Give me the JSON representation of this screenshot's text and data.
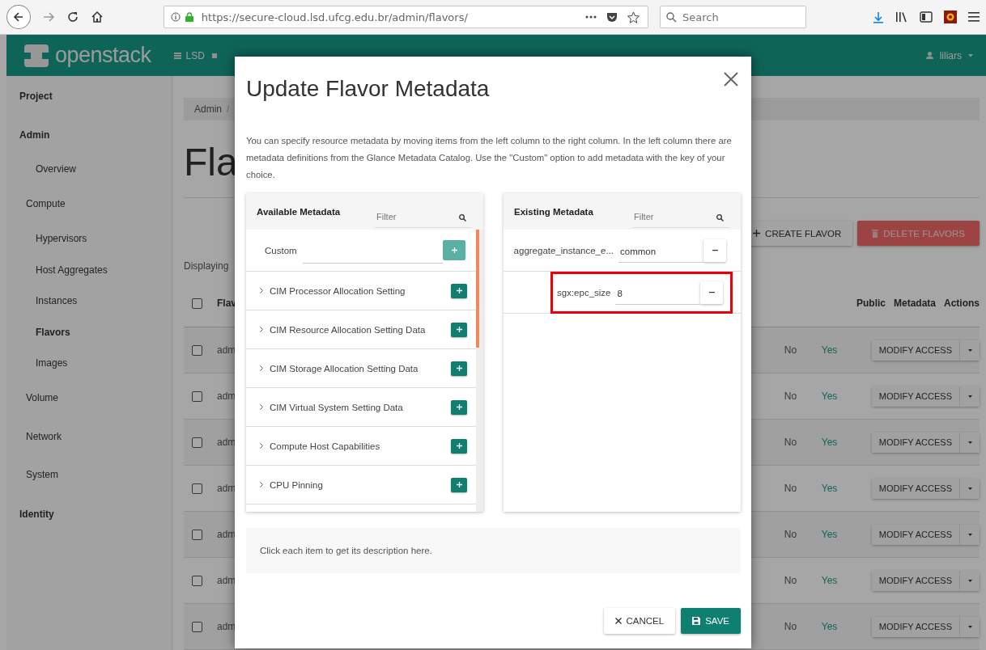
{
  "browser": {
    "url": "https://secure-cloud.lsd.ufcg.edu.br/admin/flavors/",
    "search_placeholder": "Search"
  },
  "header": {
    "logo": "openstack",
    "project": "LSD",
    "user": "liliars"
  },
  "sidebar": [
    {
      "label": "Project",
      "kind": "section"
    },
    {
      "label": "Admin",
      "kind": "section",
      "children": [
        {
          "label": "Overview",
          "kind": "item",
          "selected": false
        },
        {
          "label": "Compute",
          "kind": "group",
          "children": [
            {
              "label": "Hypervisors",
              "kind": "item",
              "selected": false
            },
            {
              "label": "Host Aggregates",
              "kind": "item",
              "selected": false
            },
            {
              "label": "Instances",
              "kind": "item",
              "selected": false
            },
            {
              "label": "Flavors",
              "kind": "item",
              "selected": true
            },
            {
              "label": "Images",
              "kind": "item",
              "selected": false
            }
          ]
        },
        {
          "label": "Volume",
          "kind": "group"
        },
        {
          "label": "Network",
          "kind": "group"
        },
        {
          "label": "System",
          "kind": "group"
        }
      ]
    },
    {
      "label": "Identity",
      "kind": "section"
    }
  ],
  "breadcrumb": {
    "items": [
      "Admin"
    ],
    "separator": "/"
  },
  "page_title": "Fla",
  "actions": [
    {
      "label": "CREATE FLAVOR",
      "kind": "create"
    },
    {
      "label": "DELETE FLAVORS",
      "kind": "delete"
    }
  ],
  "displaying": "Displaying",
  "table": {
    "select_all_checked": false,
    "columns": [
      "Flav",
      "Public",
      "Metadata",
      "Actions"
    ],
    "rows": [
      {
        "name": "adm",
        "checked": false,
        "public": "No",
        "metadata": "Yes",
        "action": "MODIFY ACCESS"
      },
      {
        "name": "adm",
        "checked": false,
        "public": "No",
        "metadata": "Yes",
        "action": "MODIFY ACCESS"
      },
      {
        "name": "adm",
        "checked": false,
        "public": "No",
        "metadata": "Yes",
        "action": "MODIFY ACCESS"
      },
      {
        "name": "adm",
        "checked": false,
        "public": "No",
        "metadata": "Yes",
        "action": "MODIFY ACCESS"
      },
      {
        "name": "adm",
        "checked": false,
        "public": "No",
        "metadata": "Yes",
        "action": "MODIFY ACCESS"
      },
      {
        "name": "adm",
        "checked": false,
        "public": "No",
        "metadata": "Yes",
        "action": "MODIFY ACCESS"
      },
      {
        "name": "adm",
        "checked": false,
        "public": "No",
        "metadata": "Yes",
        "action": "MODIFY ACCESS"
      }
    ]
  },
  "modal": {
    "title": "Update Flavor Metadata",
    "description": "You can specify resource metadata by moving items from the left column to the right column. In the left column there are metadata definitions from the Glance Metadata Catalog. Use the \"Custom\" option to add metadata with the key of your choice.",
    "available": {
      "title": "Available Metadata",
      "filter_placeholder": "Filter",
      "custom": {
        "label": "Custom",
        "add_disabled": true
      },
      "items": [
        "CIM Processor Allocation Setting",
        "CIM Resource Allocation Setting Data",
        "CIM Storage Allocation Setting Data",
        "CIM Virtual System Setting Data",
        "Compute Host Capabilities",
        "CPU Pinning"
      ]
    },
    "existing": {
      "title": "Existing Metadata",
      "filter_placeholder": "Filter",
      "items": [
        {
          "key": "aggregate_instance_e...",
          "value": "common",
          "highlighted": false
        },
        {
          "key": "sgx:epc_size",
          "value": "8",
          "highlighted": true
        }
      ]
    },
    "help": "Click each item to get its description here.",
    "buttons": [
      {
        "label": "CANCEL",
        "kind": "cancel"
      },
      {
        "label": "SAVE",
        "kind": "save"
      }
    ]
  }
}
